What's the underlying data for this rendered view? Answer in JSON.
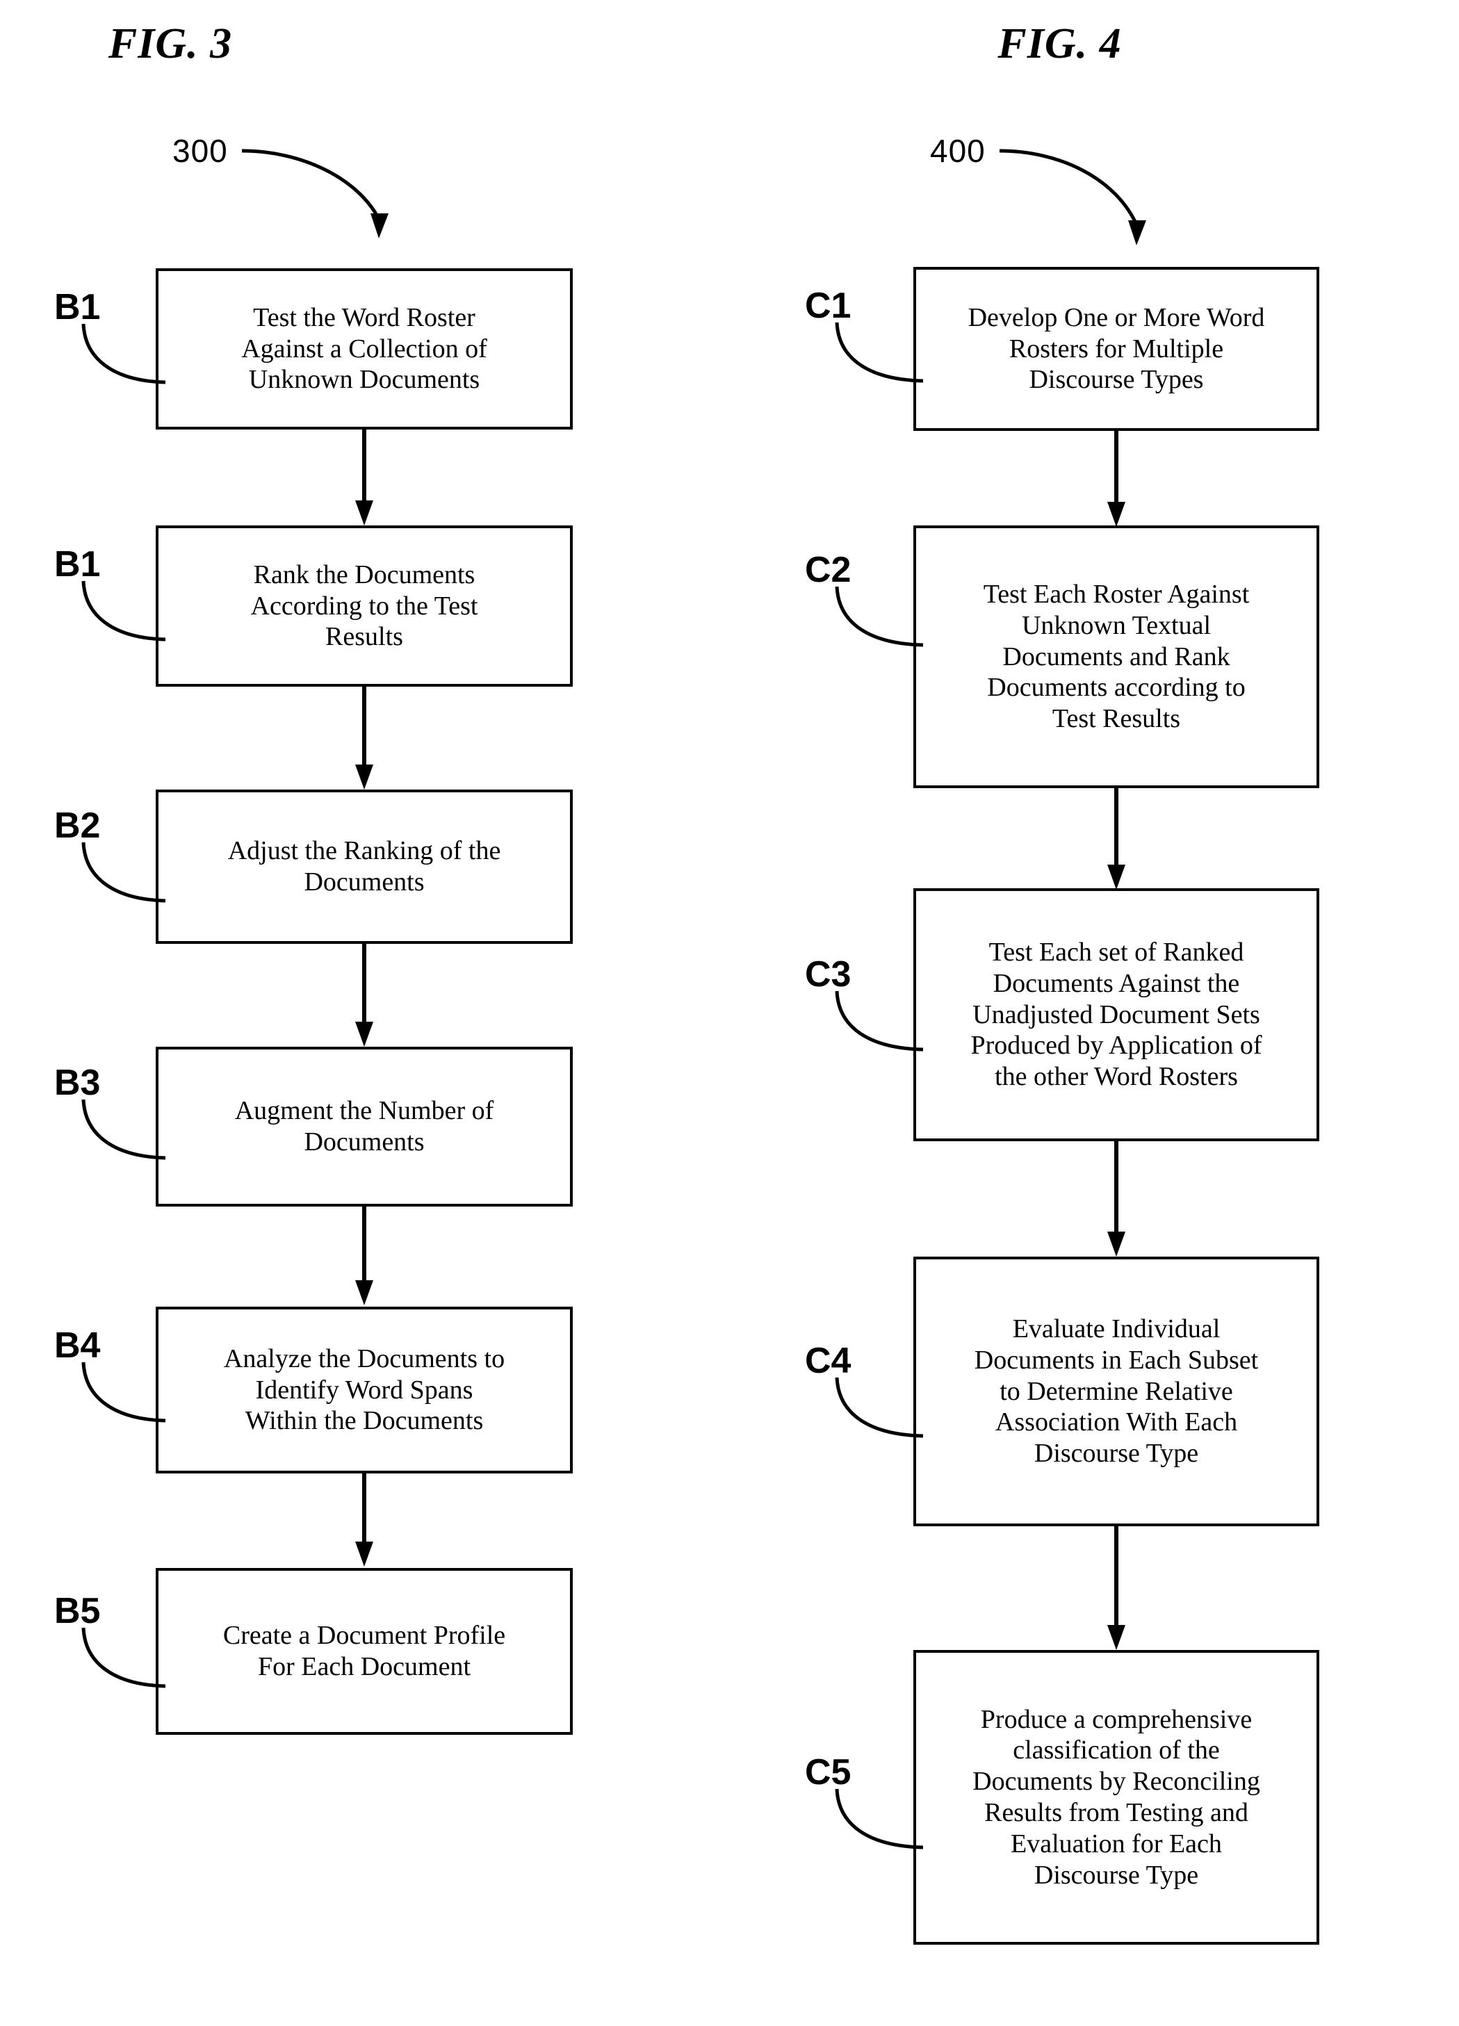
{
  "figures": [
    {
      "id": "fig3",
      "title": "FIG. 3",
      "reference_numeral": "300",
      "steps": [
        {
          "tag": "B1",
          "text": "Test the Word Roster\nAgainst a Collection of\nUnknown Documents"
        },
        {
          "tag": "B1",
          "text": "Rank the Documents\nAccording to the Test\nResults"
        },
        {
          "tag": "B2",
          "text": "Adjust the Ranking of the\nDocuments"
        },
        {
          "tag": "B3",
          "text": "Augment the Number of\nDocuments"
        },
        {
          "tag": "B4",
          "text": "Analyze the Documents to\nIdentify Word Spans\nWithin the Documents"
        },
        {
          "tag": "B5",
          "text": "Create a Document Profile\nFor Each Document"
        }
      ]
    },
    {
      "id": "fig4",
      "title": "FIG. 4",
      "reference_numeral": "400",
      "steps": [
        {
          "tag": "C1",
          "text": "Develop One or More Word\nRosters for Multiple\nDiscourse Types"
        },
        {
          "tag": "C2",
          "text": "Test Each Roster Against\nUnknown Textual\nDocuments and Rank\nDocuments according to\nTest Results"
        },
        {
          "tag": "C3",
          "text": "Test Each set of Ranked\nDocuments Against the\nUnadjusted Document Sets\nProduced by Application of\nthe other Word Rosters"
        },
        {
          "tag": "C4",
          "text": "Evaluate Individual\nDocuments in Each Subset\nto Determine Relative\nAssociation With Each\nDiscourse Type"
        },
        {
          "tag": "C5",
          "text": "Produce a comprehensive\nclassification of the\nDocuments by Reconciling\nResults from Testing and\nEvaluation for Each\nDiscourse Type"
        }
      ]
    }
  ],
  "colors": {
    "ink": "#000000",
    "paper": "#ffffff"
  }
}
